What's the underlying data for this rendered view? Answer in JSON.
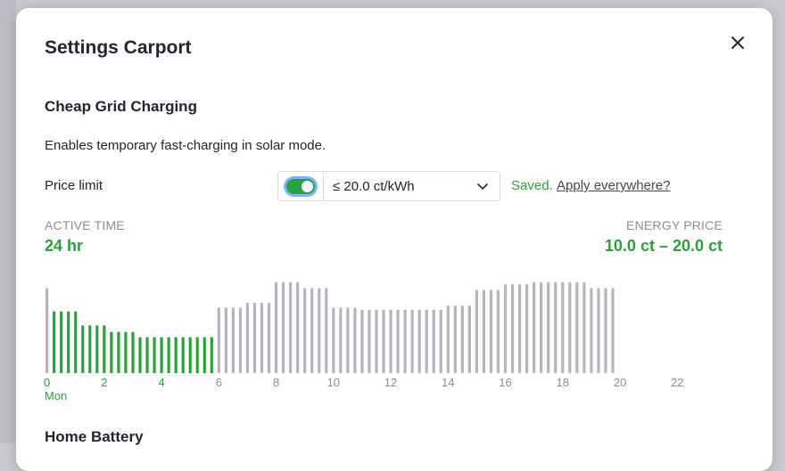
{
  "modal": {
    "title": "Settings Carport"
  },
  "cheap_grid": {
    "title": "Cheap Grid Charging",
    "description": "Enables temporary fast-charging in solar mode.",
    "price_limit_label": "Price limit",
    "toggle_on": true,
    "selected_price": "≤ 20.0 ct/kWh",
    "saved_text": "Saved.",
    "apply_link": "Apply everywhere?"
  },
  "kpis": {
    "active_time_label": "ACTIVE TIME",
    "active_time_value": "24 hr",
    "energy_price_label": "ENERGY PRICE",
    "energy_price_value": "10.0 ct – 20.0 ct"
  },
  "colors": {
    "active": "#27a236",
    "inactive": "#b5b5bd"
  },
  "chart_data": {
    "type": "bar",
    "x_ticks": [
      "0",
      "2",
      "4",
      "6",
      "8",
      "10",
      "12",
      "14",
      "16",
      "18",
      "20",
      "22"
    ],
    "day_label": "Mon",
    "ylim": [
      0,
      22.1
    ],
    "values": [
      20.7,
      15.0,
      15.0,
      15.0,
      15.0,
      11.6,
      11.6,
      11.6,
      11.6,
      10.0,
      10.0,
      10.0,
      10.0,
      8.7,
      8.7,
      8.7,
      8.7,
      8.7,
      8.7,
      8.7,
      8.7,
      8.7,
      8.7,
      8.7,
      15.9,
      15.9,
      15.9,
      15.9,
      17.1,
      17.1,
      17.1,
      17.1,
      22.1,
      22.1,
      22.1,
      22.1,
      20.7,
      20.7,
      20.7,
      20.7,
      15.9,
      15.9,
      15.9,
      15.9,
      15.4,
      15.4,
      15.4,
      15.4,
      15.4,
      15.4,
      15.4,
      15.4,
      15.4,
      15.4,
      15.4,
      15.4,
      16.4,
      16.4,
      16.4,
      16.4,
      20.2,
      20.2,
      20.2,
      20.2,
      21.6,
      21.6,
      21.6,
      21.6,
      22.1,
      22.1,
      22.1,
      22.1,
      23.6,
      23.6,
      23.6,
      23.6,
      20.7,
      20.7,
      20.7,
      20.7
    ],
    "active": [
      false,
      true,
      true,
      true,
      true,
      true,
      true,
      true,
      true,
      true,
      true,
      true,
      true,
      true,
      true,
      true,
      true,
      true,
      true,
      true,
      true,
      true,
      true,
      true,
      false,
      false,
      false,
      false,
      false,
      false,
      false,
      false,
      false,
      false,
      false,
      false,
      false,
      false,
      false,
      false,
      false,
      false,
      false,
      false,
      false,
      false,
      false,
      false,
      false,
      false,
      false,
      false,
      false,
      false,
      false,
      false,
      false,
      false,
      false,
      false,
      false,
      false,
      false,
      false,
      false,
      false,
      false,
      false,
      false,
      false,
      false,
      false,
      false,
      false,
      false,
      false,
      false,
      false,
      false,
      false
    ]
  },
  "home_battery": {
    "title": "Home Battery"
  }
}
